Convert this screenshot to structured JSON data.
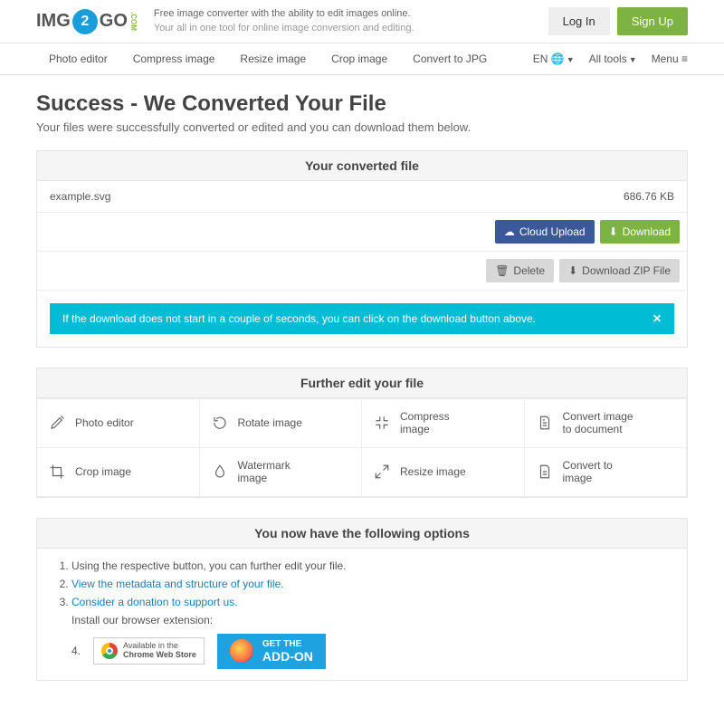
{
  "header": {
    "logo_img": "IMG",
    "logo_go": "GO",
    "logo_2": "2",
    "logo_com": ".COM",
    "tagline1": "Free image converter with the ability to edit images online.",
    "tagline2": "Your all in one tool for online image conversion and editing.",
    "login": "Log In",
    "signup": "Sign Up"
  },
  "nav": {
    "i0": "Photo editor",
    "i1": "Compress image",
    "i2": "Resize image",
    "i3": "Crop image",
    "i4": "Convert to JPG",
    "lang": "EN",
    "alltools": "All tools",
    "menu": "Menu"
  },
  "page": {
    "title": "Success - We Converted Your File",
    "sub": "Your files were successfully converted or edited and you can download them below."
  },
  "file": {
    "panel_title": "Your converted file",
    "name": "example.svg",
    "size": "686.76 KB",
    "cloud": "Cloud Upload",
    "download": "Download",
    "delete": "Delete",
    "zip": "Download ZIP File",
    "alert": "If the download does not start in a couple of seconds, you can click on the download button above."
  },
  "tools": {
    "title": "Further edit your file",
    "t0": "Photo editor",
    "t1": "Rotate image",
    "t2": "Compress image",
    "t3": "Convert image to document",
    "t4": "Crop image",
    "t5": "Watermark image",
    "t6": "Resize image",
    "t7": "Convert to image"
  },
  "opts": {
    "title": "You now have the following options",
    "o1": "Using the respective button, you can further edit your file.",
    "o2": "View the metadata and structure of your file.",
    "o3": "Consider a donation to support us.",
    "o4pre": "Install our browser extension:",
    "chrome1": "Available in the",
    "chrome2": "Chrome Web Store",
    "ff1": "GET THE",
    "ff2": "ADD-ON"
  }
}
